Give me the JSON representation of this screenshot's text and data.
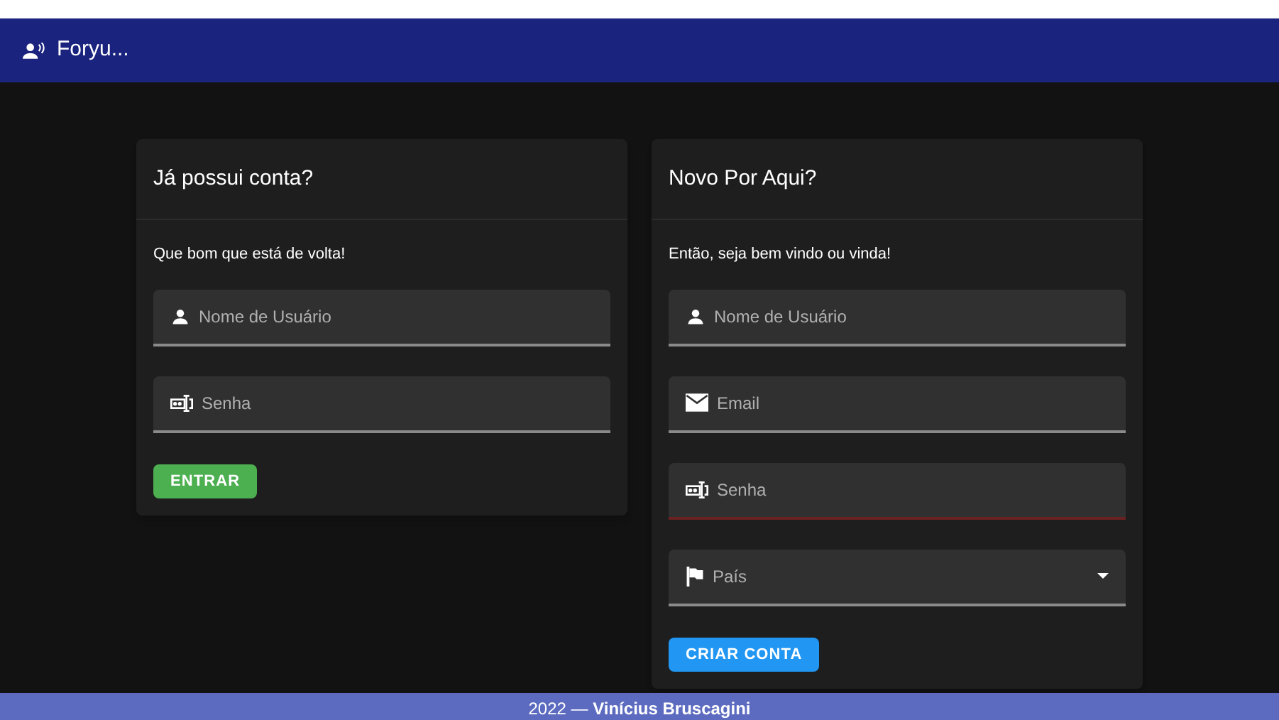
{
  "app_bar": {
    "title": "Foryu..."
  },
  "cards": [
    {
      "title": "Já possui conta?",
      "subtitle": "Que bom que está de volta!",
      "fields": [
        {
          "kind": "username",
          "placeholder": "Nome de Usuário",
          "error": false
        },
        {
          "kind": "password",
          "placeholder": "Senha",
          "error": false
        }
      ],
      "button": {
        "label": "ENTRAR",
        "color": "#4caf50"
      }
    },
    {
      "title": "Novo Por Aqui?",
      "subtitle": "Então, seja bem vindo ou vinda!",
      "fields": [
        {
          "kind": "username",
          "placeholder": "Nome de Usuário",
          "error": false
        },
        {
          "kind": "email",
          "placeholder": "Email",
          "error": false
        },
        {
          "kind": "password",
          "placeholder": "Senha",
          "error": true
        },
        {
          "kind": "country",
          "placeholder": "País",
          "error": false
        }
      ],
      "button": {
        "label": "CRIAR CONTA",
        "color": "#2196f3"
      }
    }
  ],
  "footer": {
    "text": "2022 — **Vinícius Bruscagini**"
  }
}
